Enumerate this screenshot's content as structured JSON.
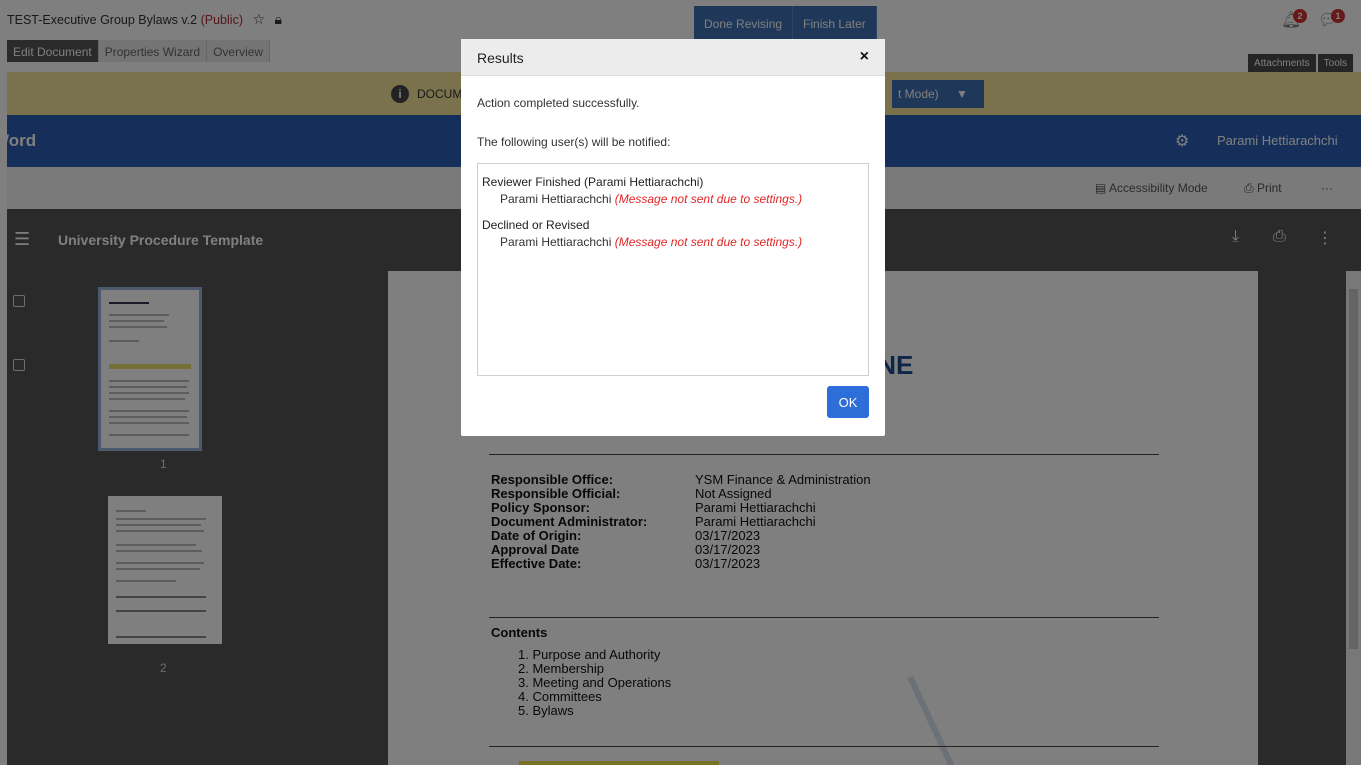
{
  "header": {
    "doc_title": "TEST-Executive Group Bylaws v.2",
    "visibility": "(Public)",
    "done_revising": "Done Revising",
    "finish_later": "Finish Later",
    "bell_count": "2",
    "chat_count": "1"
  },
  "tabs": [
    {
      "label": "Edit Document"
    },
    {
      "label": "Properties Wizard"
    },
    {
      "label": "Overview"
    }
  ],
  "right_tabs": [
    {
      "label": "Attachments"
    },
    {
      "label": "Tools"
    }
  ],
  "infobar": {
    "text": "DOCUM",
    "mode_label": "t Mode)"
  },
  "word_bar": {
    "title": "Word",
    "user": "Parami Hettiarachchi"
  },
  "toolbar": {
    "accessibility": "Accessibility Mode",
    "print": "Print",
    "more": "···"
  },
  "viewer": {
    "title": "University Procedure Template",
    "thumb_page_1": "1",
    "thumb_page_2": "2"
  },
  "document": {
    "partial_heading": "INE",
    "fields": [
      {
        "key": "Responsible Office:",
        "value": "YSM Finance & Administration"
      },
      {
        "key": "Responsible Official:",
        "value": "Not Assigned"
      },
      {
        "key": "Policy Sponsor:",
        "value": "Parami Hettiarachchi"
      },
      {
        "key": "Document Administrator:",
        "value": "Parami Hettiarachchi"
      },
      {
        "key": "Date of Origin:",
        "value": "03/17/2023"
      },
      {
        "key": "Approval Date",
        "value": "03/17/2023"
      },
      {
        "key": "Effective Date:",
        "value": "03/17/2023"
      }
    ],
    "contents_title": "Contents",
    "contents": [
      "1.  Purpose and Authority",
      "2.  Membership",
      "3.  Meeting and Operations",
      "4.  Committees",
      "5.  Bylaws"
    ]
  },
  "modal": {
    "title": "Results",
    "close": "×",
    "message": "Action completed successfully.",
    "notify_label": "The following user(s) will be notified:",
    "groups": [
      {
        "name": "Reviewer Finished (Parami Hettiarachchi)",
        "user": "Parami Hettiarachchi",
        "note": "(Message not sent due to settings.)"
      },
      {
        "name": "Declined or Revised",
        "user": "Parami Hettiarachchi",
        "note": "(Message not sent due to settings.)"
      }
    ],
    "ok_label": "OK"
  }
}
